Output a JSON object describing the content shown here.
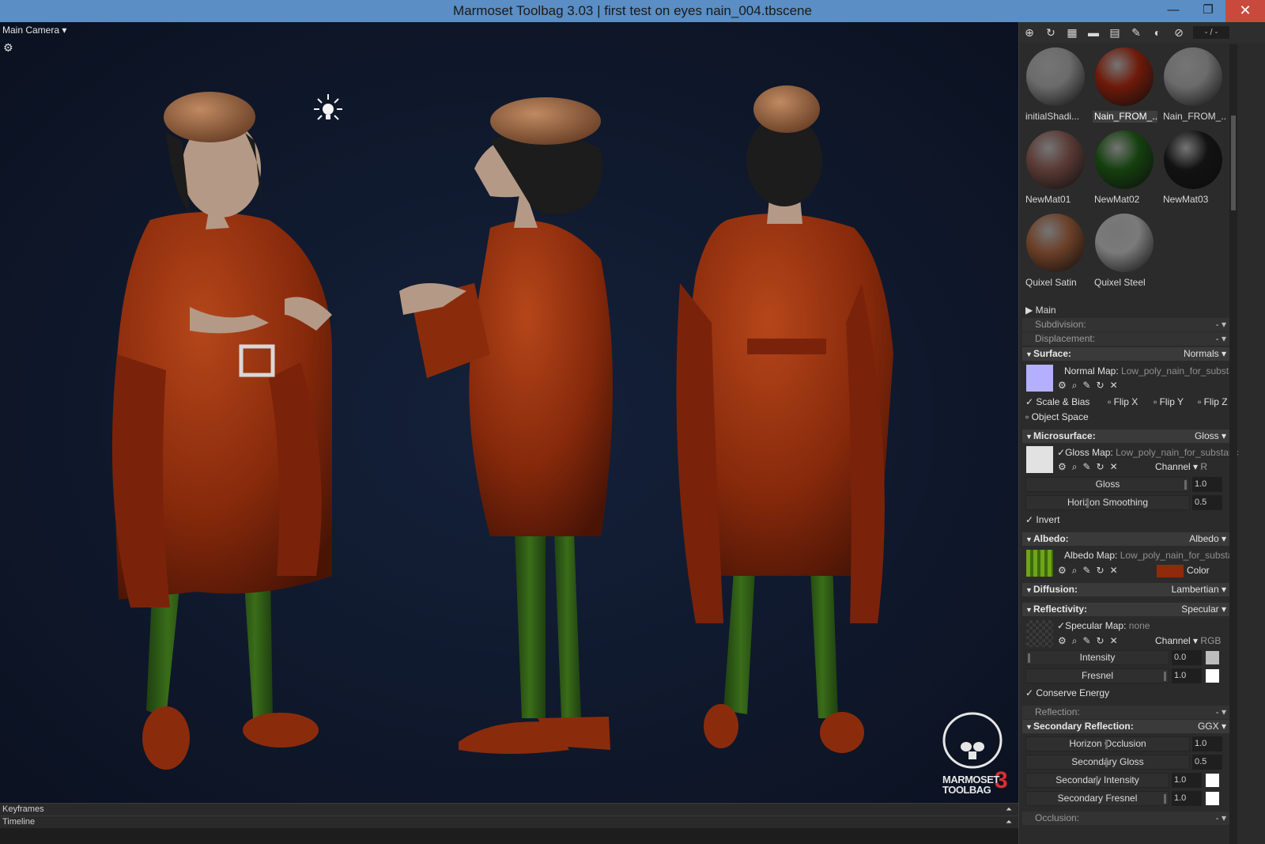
{
  "window": {
    "title": "Marmoset Toolbag 3.03  |  first test on eyes nain_004.tbscene",
    "minimize": "—",
    "restore": "❐",
    "close": "✕"
  },
  "viewport": {
    "camera_label": "Main Camera ▾",
    "settings_icon": "gear-icon",
    "light_icon": "light-bulb-icon",
    "logo": {
      "line1": "MARMOSET",
      "line2": "TOOLBAG",
      "mark": "3"
    }
  },
  "bottom": {
    "keyframes_label": "Keyframes",
    "timeline_label": "Timeline"
  },
  "toolbar": {
    "icons": [
      "add-material-icon",
      "duplicate-icon",
      "checker-icon",
      "folder-icon",
      "trash-icon",
      "dropper-icon",
      "sphere-icon",
      "clear-icon"
    ],
    "pager": "- / -"
  },
  "materials": [
    {
      "name": "initialShadi...",
      "color": "#6b6b6b",
      "selected": false
    },
    {
      "name": "Nain_FROM_...",
      "color": "#6e1a0a",
      "selected": true
    },
    {
      "name": "Nain_FROM_...",
      "color": "#6b6b6b",
      "selected": false
    },
    {
      "name": "NewMat01",
      "color": "#5a3a35",
      "selected": false
    },
    {
      "name": "NewMat02",
      "color": "#15400f",
      "selected": false
    },
    {
      "name": "NewMat03",
      "color": "#121212",
      "selected": false
    },
    {
      "name": "Quixel Satin",
      "color": "#6b3f28",
      "selected": false
    },
    {
      "name": "Quixel Steel",
      "color": "#7a7a7a",
      "selected": false
    }
  ],
  "props": {
    "main": "Main",
    "subdivision": {
      "label": "Subdivision:",
      "value": "-"
    },
    "displacement": {
      "label": "Displacement:",
      "value": "-"
    },
    "surface": {
      "label": "Surface:",
      "mode": "Normals"
    },
    "normal_map": {
      "label": "Normal Map:",
      "value": "Low_poly_nain_for_substar"
    },
    "scale_bias": "Scale & Bias",
    "flip_x": "Flip X",
    "flip_y": "Flip Y",
    "flip_z": "Flip Z",
    "object_space": "Object Space",
    "microsurface": {
      "label": "Microsurface:",
      "mode": "Gloss"
    },
    "gloss_map": {
      "label": "Gloss Map:",
      "value": "Low_poly_nain_for_substanc"
    },
    "gloss_channel": {
      "label": "Channel ▾",
      "value": "R"
    },
    "gloss": {
      "label": "Gloss",
      "value": "1.0"
    },
    "horizon_smoothing": {
      "label": "Horizon Smoothing",
      "value": "0.5"
    },
    "invert": "Invert",
    "albedo": {
      "label": "Albedo:",
      "mode": "Albedo"
    },
    "albedo_map": {
      "label": "Albedo Map:",
      "value": "Low_poly_nain_for_substar"
    },
    "albedo_color_label": "Color",
    "albedo_color": "#8f2a0c",
    "diffusion": {
      "label": "Diffusion:",
      "mode": "Lambertian"
    },
    "reflectivity": {
      "label": "Reflectivity:",
      "mode": "Specular"
    },
    "specular_map": {
      "label": "Specular Map:",
      "value": "none"
    },
    "spec_channel": {
      "label": "Channel ▾",
      "value": "RGB"
    },
    "intensity": {
      "label": "Intensity",
      "value": "0.0"
    },
    "fresnel": {
      "label": "Fresnel",
      "value": "1.0"
    },
    "conserve_energy": "Conserve Energy",
    "reflection": {
      "label": "Reflection:",
      "value": "-"
    },
    "secondary_reflection": {
      "label": "Secondary Reflection:",
      "mode": "GGX"
    },
    "horizon_occlusion": {
      "label": "Horizon Occlusion",
      "value": "1.0"
    },
    "secondary_gloss": {
      "label": "Secondary Gloss",
      "value": "0.5"
    },
    "secondary_intensity": {
      "label": "Secondary Intensity",
      "value": "1.0"
    },
    "secondary_fresnel": {
      "label": "Secondary Fresnel",
      "value": "1.0"
    },
    "occlusion": {
      "label": "Occlusion:",
      "value": "-"
    }
  },
  "colors": {
    "titlebar": "#5a8ec4",
    "viewport_bg": "#0f172a",
    "robe": "#8a2a0c",
    "tights": "#2d5a12",
    "hair": "#1c1c1c",
    "cap": "#9a6a48",
    "skin": "#b49a86"
  }
}
